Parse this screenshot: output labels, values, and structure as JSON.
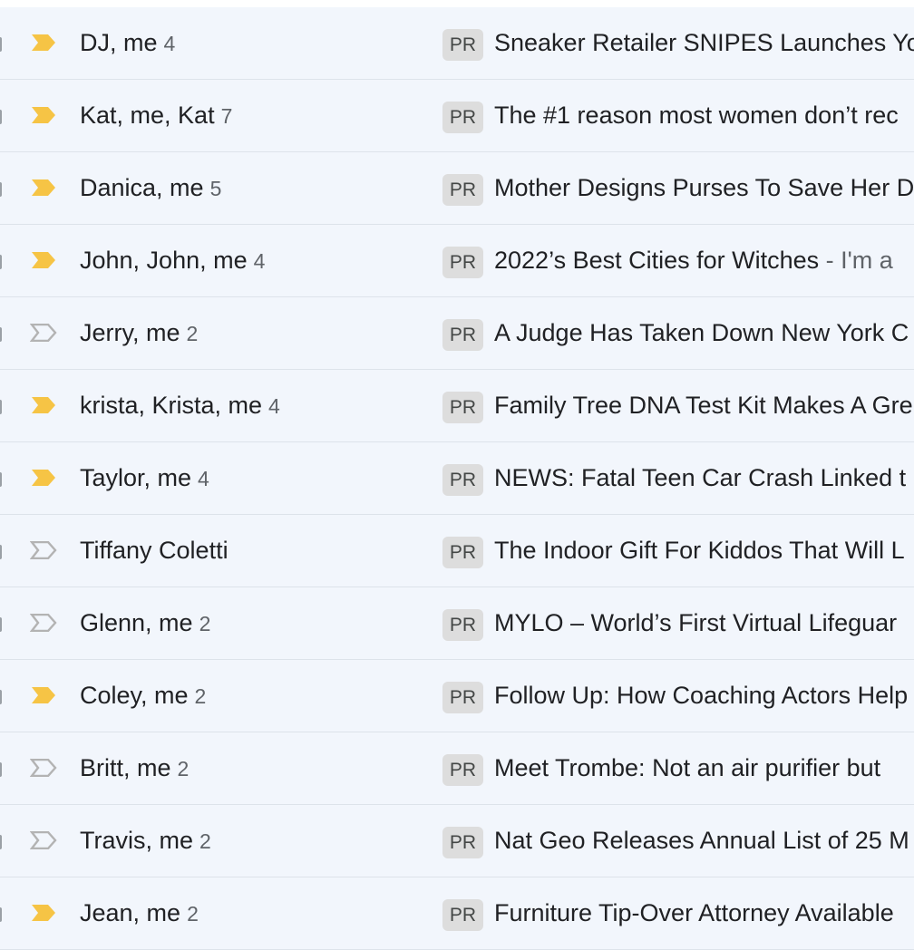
{
  "colors": {
    "row_bg": "#f2f6fc",
    "divider": "#dde3ea",
    "important_on": "#f6c445",
    "important_off": "#b3b3b3",
    "label_bg": "#dddddd"
  },
  "rows": [
    {
      "senders": "DJ, me",
      "count": "4",
      "important": true,
      "label": "PR",
      "subject": "Sneaker Retailer SNIPES Launches Yo",
      "snippet": ""
    },
    {
      "senders": "Kat, me, Kat",
      "count": "7",
      "important": true,
      "label": "PR",
      "subject": "The #1 reason most women don’t rec",
      "snippet": ""
    },
    {
      "senders": "Danica, me",
      "count": "5",
      "important": true,
      "label": "PR",
      "subject": "Mother Designs Purses To Save Her D",
      "snippet": ""
    },
    {
      "senders": "John, John, me",
      "count": "4",
      "important": true,
      "label": "PR",
      "subject": "2022’s Best Cities for Witches",
      "snippet": " - I'm a"
    },
    {
      "senders": "Jerry, me",
      "count": "2",
      "important": false,
      "label": "PR",
      "subject": "A Judge Has Taken Down New York C",
      "snippet": ""
    },
    {
      "senders": "krista, Krista, me",
      "count": "4",
      "important": true,
      "label": "PR",
      "subject": "Family Tree DNA Test Kit Makes A Gre",
      "snippet": ""
    },
    {
      "senders": "Taylor, me",
      "count": "4",
      "important": true,
      "label": "PR",
      "subject": "NEWS: Fatal Teen Car Crash Linked t",
      "snippet": ""
    },
    {
      "senders": "Tiffany Coletti",
      "count": "",
      "important": false,
      "label": "PR",
      "subject": "The Indoor Gift For Kiddos That Will L",
      "snippet": ""
    },
    {
      "senders": "Glenn, me",
      "count": "2",
      "important": false,
      "label": "PR",
      "subject": "MYLO – World’s First Virtual Lifeguar",
      "snippet": ""
    },
    {
      "senders": "Coley, me",
      "count": "2",
      "important": true,
      "label": "PR",
      "subject": "Follow Up: How Coaching Actors Help",
      "snippet": ""
    },
    {
      "senders": "Britt, me",
      "count": "2",
      "important": false,
      "label": "PR",
      "subject": "Meet Trombe: Not an air purifier but",
      "snippet": ""
    },
    {
      "senders": "Travis, me",
      "count": "2",
      "important": false,
      "label": "PR",
      "subject": "Nat Geo Releases Annual List of 25 M",
      "snippet": ""
    },
    {
      "senders": "Jean, me",
      "count": "2",
      "important": true,
      "label": "PR",
      "subject": "Furniture Tip-Over Attorney Available",
      "snippet": ""
    }
  ]
}
